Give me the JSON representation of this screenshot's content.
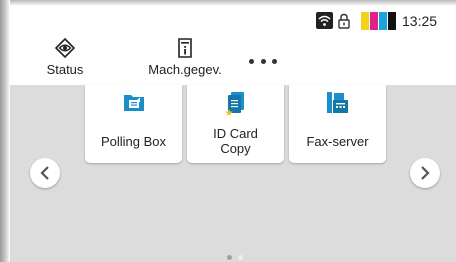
{
  "status_bar": {
    "time": "13:25",
    "icons": [
      "wifi-icon",
      "lock-icon",
      "toner-level-icon"
    ],
    "toner_colors": [
      "#f3d21c",
      "#e0218a",
      "#19a4dc",
      "#111111"
    ]
  },
  "header": {
    "status_label": "Status",
    "status_icon": "eye-diamond-icon",
    "machine_label": "Mach.gegev.",
    "machine_icon": "info-document-icon",
    "more_icon": "more-dots-icon"
  },
  "tiles": [
    {
      "label": "Polling Box",
      "icon": "folder-polling-icon"
    },
    {
      "label": "ID Card\nCopy",
      "label_line1": "ID Card",
      "label_line2": "Copy",
      "icon": "id-card-copy-icon"
    },
    {
      "label": "Fax-server",
      "icon": "fax-server-icon"
    }
  ],
  "navigation": {
    "prev_icon": "chevron-left-icon",
    "next_icon": "chevron-right-icon",
    "page_count": 2,
    "current_page": 1
  },
  "colors": {
    "accent_blue": "#1a8fc8",
    "panel_bg": "#dcdcdc",
    "star_yellow": "#f0c020"
  }
}
